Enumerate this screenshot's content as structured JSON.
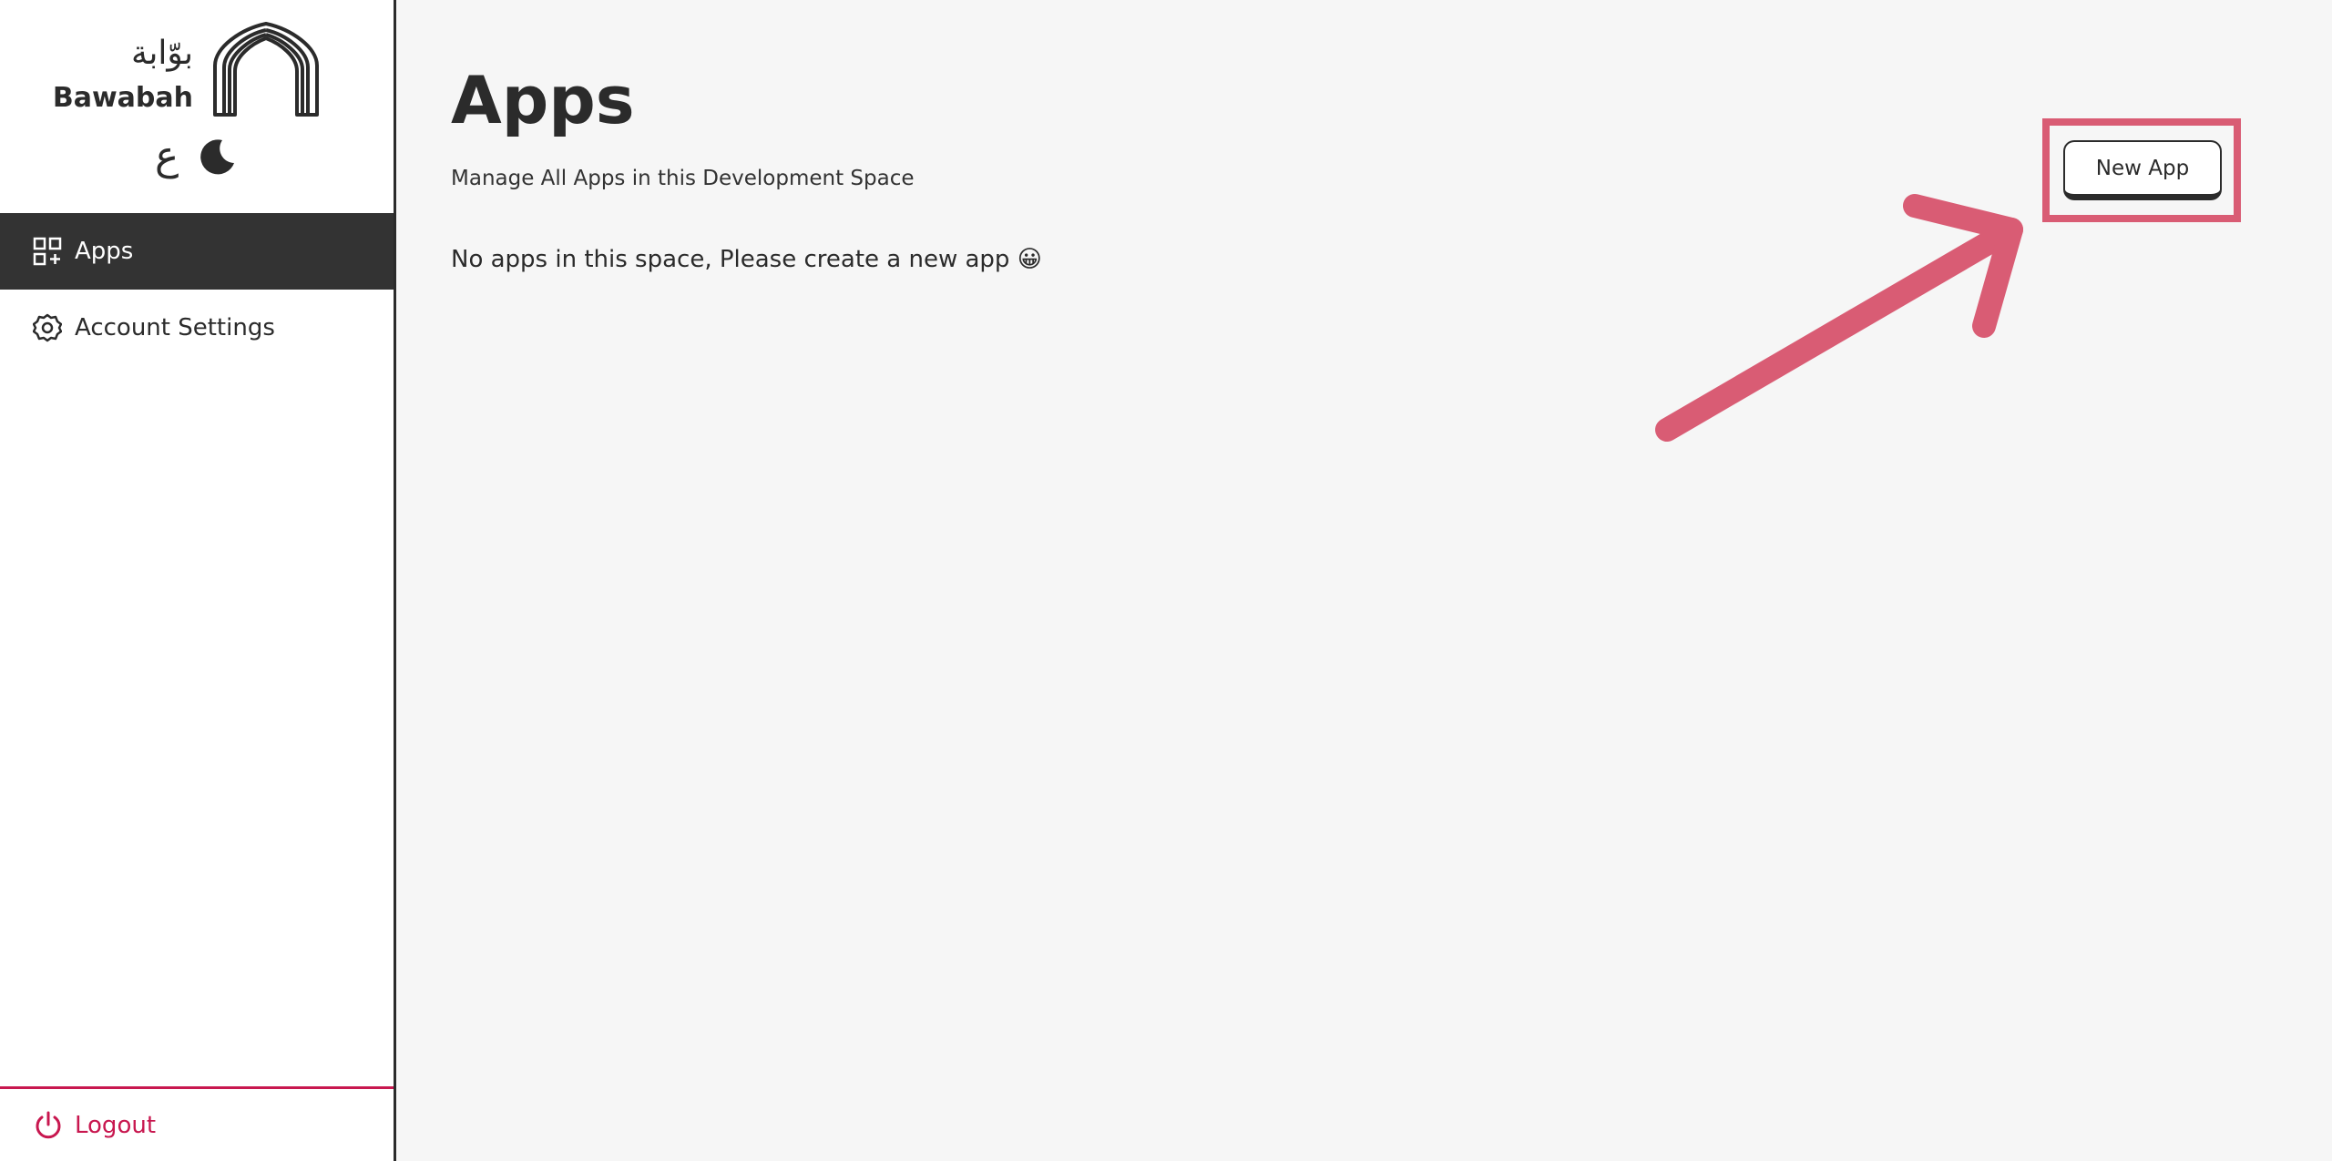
{
  "brand": {
    "arabic_name": "بوّابة",
    "name": "Bawabah"
  },
  "toggles": {
    "language_label": "ع",
    "theme_icon": "moon-icon"
  },
  "sidebar": {
    "items": [
      {
        "label": "Apps",
        "icon": "apps-grid-icon",
        "active": true
      },
      {
        "label": "Account Settings",
        "icon": "gear-icon",
        "active": false
      }
    ],
    "logout_label": "Logout",
    "logout_icon": "power-icon"
  },
  "main": {
    "title": "Apps",
    "subtitle": "Manage All Apps in this Development Space",
    "empty_message": "No apps in this space, Please create a new app 😀",
    "new_app_label": "New App"
  },
  "colors": {
    "sidebar_active_bg": "#333333",
    "accent_logout": "#c8174f",
    "annotation": "#d95c74",
    "background": "#f6f6f6"
  }
}
